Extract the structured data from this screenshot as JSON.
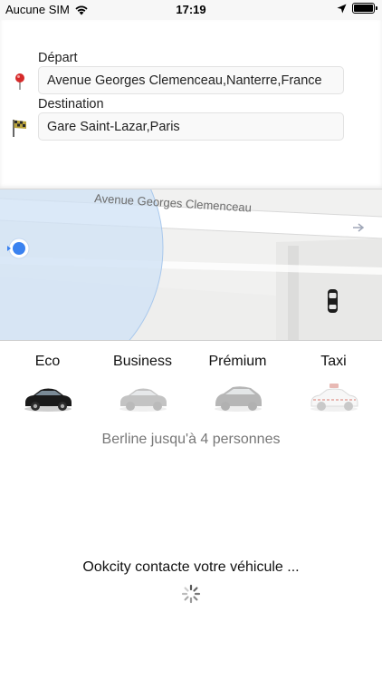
{
  "status_bar": {
    "carrier": "Aucune SIM",
    "time": "17:19"
  },
  "form": {
    "departure_label": "Départ",
    "departure_value": "Avenue Georges Clemenceau,Nanterre,France",
    "destination_label": "Destination",
    "destination_value": "Gare Saint-Lazar,Paris"
  },
  "map": {
    "street_name": "Avenue Georges Clemenceau"
  },
  "vehicles": [
    {
      "label": "Eco",
      "selected": true
    },
    {
      "label": "Business",
      "selected": false
    },
    {
      "label": "Prémium",
      "selected": false
    },
    {
      "label": "Taxi",
      "selected": false
    }
  ],
  "vehicle_description": "Berline jusqu'à 4 personnes",
  "contact_message": "Ookcity contacte votre véhicule ...",
  "colors": {
    "location_blue": "#3a82f0",
    "accuracy_circle": "#cfe1f5",
    "pin_red": "#d62a2a"
  }
}
